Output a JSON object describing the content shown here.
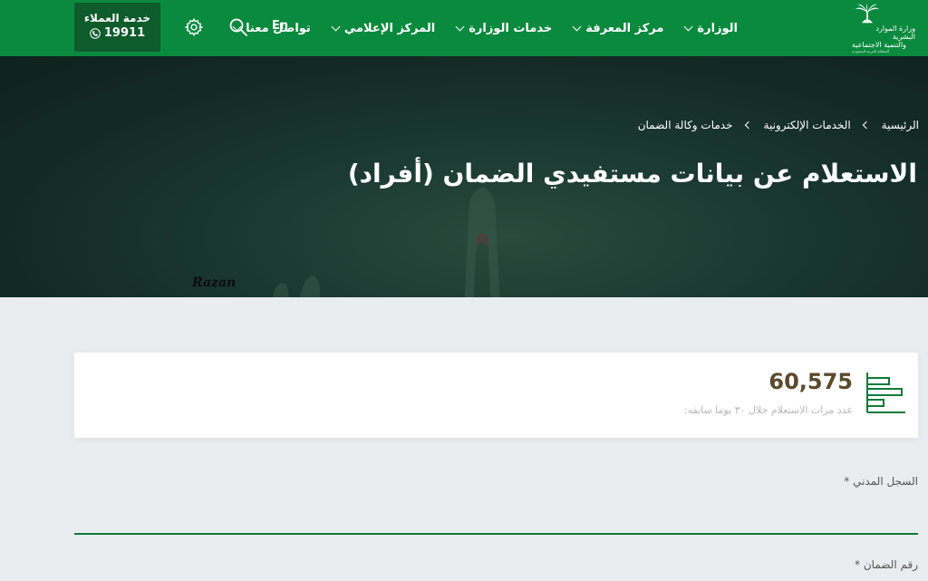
{
  "nav": {
    "logo": {
      "line1": "وزارة الموارد البشرية",
      "line2": "والتنمية الاجتماعية",
      "line3": "المملكة العربية السعودية"
    },
    "menu": [
      {
        "label": "الوزارة"
      },
      {
        "label": "مركز المعرفة"
      },
      {
        "label": "خدمات الوزارة"
      },
      {
        "label": "المركز الإعلامي"
      },
      {
        "label": "تواصل معنا"
      }
    ],
    "lang_label": "En",
    "customer_service": {
      "title": "خدمة العملاء",
      "number": "19911"
    }
  },
  "hero": {
    "breadcrumbs": [
      "الرئيسية",
      "الخدمات الإلكترونية",
      "خدمات وكالة الضمان"
    ],
    "title": "الاستعلام عن بيانات مستفيدي الضمان (أفراد)",
    "watermark": "Razan"
  },
  "stats": {
    "value": "60,575",
    "caption": "عدد مرات الاستعلام خلال ٣٠ يوما سابقه:"
  },
  "form": {
    "national_id_label": "السجل المدني *",
    "security_number_label": "رقم الضمان *"
  },
  "colors": {
    "nav_green": "#0a8a3e",
    "dark_green": "#0e5c2c",
    "stat_brown": "#5b4a2e",
    "page_bg": "#e9edf0"
  }
}
